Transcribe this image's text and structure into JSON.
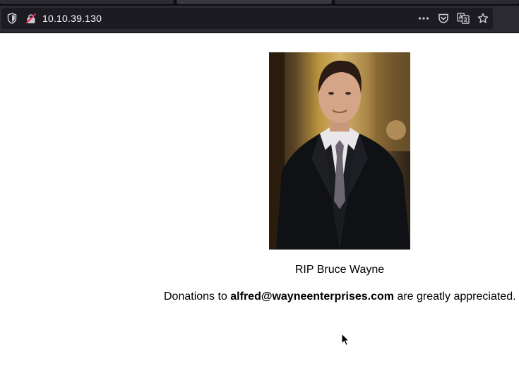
{
  "browser": {
    "url": "10.10.39.130",
    "icons": {
      "tracking": "shield-icon",
      "security": "insecure-lock-icon",
      "more": "ellipsis-icon",
      "pocket": "pocket-icon",
      "translate": "translate-icon",
      "bookmark": "star-icon"
    }
  },
  "page": {
    "image": "portrait-photo",
    "caption": "RIP Bruce Wayne",
    "donations": {
      "prefix": "Donations to ",
      "email": "alfred@wayneenterprises.com",
      "suffix": " are greatly appreciated."
    }
  }
}
